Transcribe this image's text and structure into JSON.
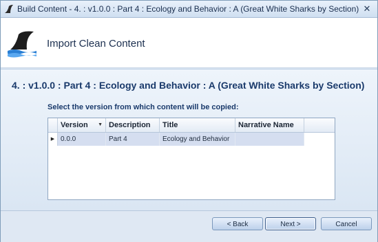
{
  "window": {
    "title": "Build Content - 4. : v1.0.0 : Part 4 : Ecology and Behavior : A (Great White Sharks by Section)",
    "close_glyph": "✕"
  },
  "header": {
    "title": "Import Clean Content",
    "logo_icon": "shark-fin-icon"
  },
  "main": {
    "breadcrumb": "4. : v1.0.0 : Part 4 : Ecology and Behavior : A (Great White Sharks by Section)",
    "instruction": "Select the version from which content will be copied:",
    "grid": {
      "columns": [
        "Version",
        "Description",
        "Title",
        "Narrative Name"
      ],
      "sort_glyph": "▼",
      "row_marker_glyph": "▶",
      "rows": [
        {
          "version": "0.0.0",
          "description": "Part 4",
          "title": "Ecology and Behavior",
          "narrative": ""
        }
      ]
    }
  },
  "footer": {
    "back_label": "< Back",
    "next_label": "Next >",
    "cancel_label": "Cancel"
  },
  "colors": {
    "accent": "#1a3a6b",
    "selected_row": "#d5def0"
  }
}
